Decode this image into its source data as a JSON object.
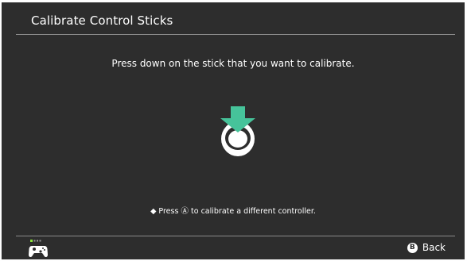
{
  "header": {
    "title": "Calibrate Control Sticks"
  },
  "main": {
    "instruction": "Press down on the stick that you want to calibrate.",
    "illustration_icon": "stick-press-down-icon",
    "hint_bullet": "◆",
    "hint_prefix": "Press",
    "hint_button": "Ⓐ",
    "hint_suffix": "to calibrate a different controller."
  },
  "footer": {
    "controller_icon": "pro-controller-icon",
    "player_indicator": "■□□□",
    "back_button_glyph": "B",
    "back_label": "Back"
  },
  "colors": {
    "background": "#2d2d2d",
    "accent": "#46c39a",
    "player_led": "#8de63c"
  }
}
